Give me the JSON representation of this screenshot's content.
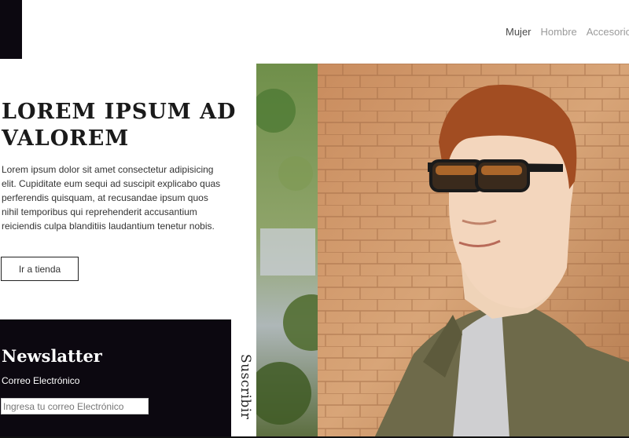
{
  "nav": {
    "items": [
      "Mujer",
      "Hombre",
      "Accesorios"
    ]
  },
  "hero": {
    "title_line1": "LOREM IPSUM AD",
    "title_line2": "VALOREM",
    "body": "Lorem ipsum dolor sit amet consectetur adipisicing elit. Cupiditate eum sequi ad suscipit explicabo quas perferendis quisquam, at recusandae ipsum quos nihil temporibus qui reprehenderit accusantium reiciendis culpa blanditiis laudantium tenetur nobis.",
    "cta_label": "Ir a tienda"
  },
  "newsletter": {
    "title": "Newslatter",
    "email_label": "Correo Electrónico",
    "email_placeholder": "Ingresa tu correo Electrónico",
    "email_value": "",
    "subscribe_label": "Suscribir"
  },
  "image": {
    "icon": "hero-photo-icon"
  },
  "colors": {
    "dark": "#0c0810",
    "text": "#2a2a2a",
    "nav_muted": "#9a9a9a",
    "nav_active": "#4a4a4a"
  }
}
